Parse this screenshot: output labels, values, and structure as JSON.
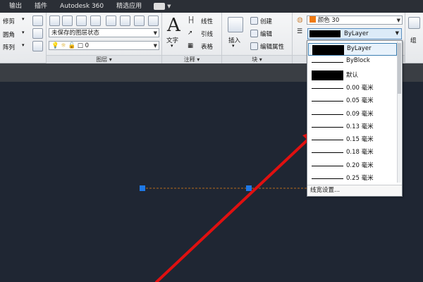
{
  "menubar": {
    "tabs": [
      "输出",
      "插件",
      "Autodesk 360",
      "精选应用"
    ]
  },
  "modify": {
    "items": [
      "修剪",
      "圆角",
      "阵列"
    ]
  },
  "layers": {
    "state_value": "未保存的图层状态",
    "current_layer": "0",
    "panel_title": "图层"
  },
  "annotation": {
    "text_label": "文字",
    "linear_label": "线性",
    "leader_label": "引线",
    "table_label": "表格",
    "panel_title": "注释"
  },
  "block": {
    "insert_label": "插入",
    "create_label": "创建",
    "edit_label": "编辑",
    "edit_attr_label": "编辑属性",
    "panel_title": "块"
  },
  "properties": {
    "color_label": "颜色 30",
    "lineweight_value": "ByLayer",
    "color_swatch": "#f07a10"
  },
  "group": {
    "label": "组"
  },
  "lineweight_list": {
    "items": [
      {
        "label": "ByLayer",
        "thick": true
      },
      {
        "label": "ByBlock",
        "thick": false
      },
      {
        "label": "默认",
        "thick": true
      },
      {
        "label": "0.00 毫米",
        "thick": false
      },
      {
        "label": "0.05 毫米",
        "thick": false
      },
      {
        "label": "0.09 毫米",
        "thick": false
      },
      {
        "label": "0.13 毫米",
        "thick": false
      },
      {
        "label": "0.15 毫米",
        "thick": false
      },
      {
        "label": "0.18 毫米",
        "thick": false
      },
      {
        "label": "0.20 毫米",
        "thick": false
      },
      {
        "label": "0.25 毫米",
        "thick": false
      }
    ],
    "footer": "线宽设置..."
  },
  "colors": {
    "grip": "#1e78e6",
    "dashed_line": "#b56a1e",
    "arrow": "#e01010"
  }
}
